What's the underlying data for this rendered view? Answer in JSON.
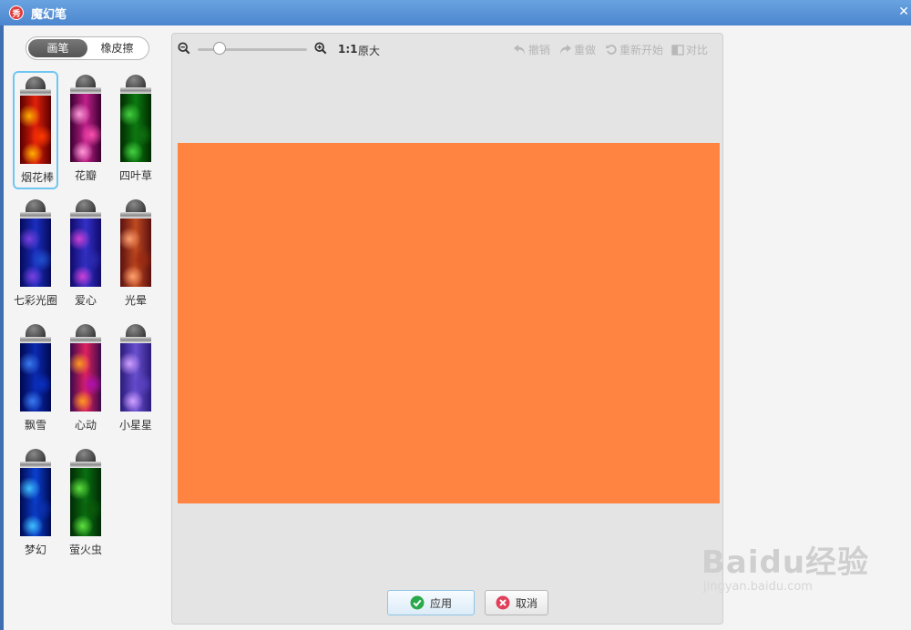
{
  "window": {
    "title": "魔幻笔",
    "app_icon_text": "秀"
  },
  "mode_toggle": {
    "options": [
      "画笔",
      "橡皮擦"
    ],
    "selected": "画笔"
  },
  "brushes": [
    {
      "label": "烟花棒",
      "colors": [
        "#5a0000",
        "#e2200a",
        "#ffb000",
        "#ff3a00"
      ],
      "selected": true
    },
    {
      "label": "花瓣",
      "colors": [
        "#3a0030",
        "#c0208a",
        "#ff9ad8",
        "#ff50b0"
      ],
      "selected": false
    },
    {
      "label": "四叶草",
      "colors": [
        "#002a00",
        "#0c7a10",
        "#44d040",
        "#107010"
      ],
      "selected": false
    },
    {
      "label": "七彩光圈",
      "colors": [
        "#050a5a",
        "#1b2ec0",
        "#7a40e0",
        "#2050d0"
      ],
      "selected": false
    },
    {
      "label": "爱心",
      "colors": [
        "#100a6a",
        "#3330c8",
        "#d040d8",
        "#2a2ab0"
      ],
      "selected": false
    },
    {
      "label": "光晕",
      "colors": [
        "#5a1010",
        "#c04a20",
        "#ffa070",
        "#9a2a10"
      ],
      "selected": false
    },
    {
      "label": "飘雪",
      "colors": [
        "#000850",
        "#0a2ab0",
        "#3a7af0",
        "#0a30c0"
      ],
      "selected": false
    },
    {
      "label": "心动",
      "colors": [
        "#3a0a4a",
        "#e02060",
        "#ff9a20",
        "#b010b0"
      ],
      "selected": false
    },
    {
      "label": "小星星",
      "colors": [
        "#2a1a7a",
        "#6a50d0",
        "#d0a0ff",
        "#5a40c0"
      ],
      "selected": false
    },
    {
      "label": "梦幻",
      "colors": [
        "#000a50",
        "#0a40d0",
        "#40c0ff",
        "#0a30b0"
      ],
      "selected": false
    },
    {
      "label": "萤火虫",
      "colors": [
        "#002a05",
        "#0a7010",
        "#60e040",
        "#0a5a0a"
      ],
      "selected": false
    }
  ],
  "toolbar": {
    "zoom_ratio": "1:1",
    "original_size_label": "原大",
    "undo_label": "撤销",
    "redo_label": "重做",
    "restart_label": "重新开始",
    "compare_label": "对比",
    "zoom_level": 0.2
  },
  "canvas": {
    "fill_color": "#ff8442"
  },
  "buttons": {
    "apply_label": "应用",
    "cancel_label": "取消"
  },
  "watermark": {
    "main": "Baidu经验",
    "sub": "jingyan.baidu.com"
  },
  "colors": {
    "titlebar": "#5a95d8",
    "selection_border": "#6ec6f2",
    "apply_icon": "#2aa84a",
    "cancel_icon": "#e0405a"
  }
}
